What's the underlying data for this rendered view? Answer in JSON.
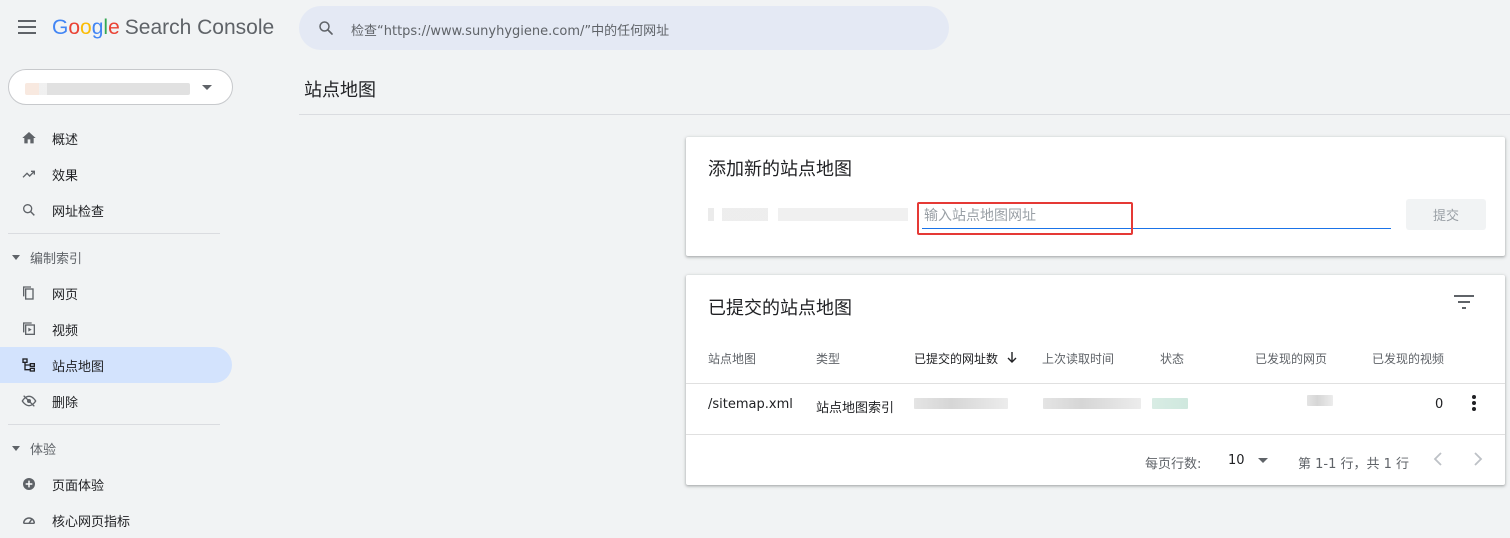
{
  "header": {
    "logo_google_letters": [
      "G",
      "o",
      "o",
      "g",
      "l",
      "e"
    ],
    "logo_product": "Search Console",
    "search_placeholder": "检查“https://www.sunyhygiene.com/”中的任何网址"
  },
  "sidebar": {
    "items_top": [
      {
        "label": "概述",
        "icon": "home-icon"
      },
      {
        "label": "效果",
        "icon": "trending-up-icon"
      },
      {
        "label": "网址检查",
        "icon": "search-icon"
      }
    ],
    "section_indexing": "编制索引",
    "items_indexing": [
      {
        "label": "网页",
        "icon": "pages-icon"
      },
      {
        "label": "视频",
        "icon": "video-icon"
      },
      {
        "label": "站点地图",
        "icon": "sitemap-icon",
        "active": true
      },
      {
        "label": "删除",
        "icon": "removals-icon"
      }
    ],
    "section_experience": "体验",
    "items_experience": [
      {
        "label": "页面体验",
        "icon": "page-experience-icon"
      },
      {
        "label": "核心网页指标",
        "icon": "core-web-vitals-icon"
      }
    ]
  },
  "main": {
    "page_title": "站点地图",
    "add_card": {
      "title": "添加新的站点地图",
      "input_placeholder": "输入站点地图网址",
      "input_value": "",
      "submit_label": "提交"
    },
    "submitted_card": {
      "title": "已提交的站点地图",
      "columns": [
        "站点地图",
        "类型",
        "已提交的网址数",
        "上次读取时间",
        "状态",
        "已发现的网页",
        "已发现的视频"
      ],
      "sorted_column": "已提交的网址数",
      "rows": [
        {
          "sitemap": "/sitemap.xml",
          "type": "站点地图索引",
          "videos": "0"
        }
      ],
      "footer": {
        "rows_per_page_label": "每页行数:",
        "rows_per_page_value": "10",
        "range_text": "第 1-1 行，共 1 行"
      }
    }
  },
  "colors": {
    "accent": "#1a73e8",
    "active_nav": "#d3e3fd",
    "highlight": "#e53935",
    "search_bg": "#e4e9f4"
  }
}
